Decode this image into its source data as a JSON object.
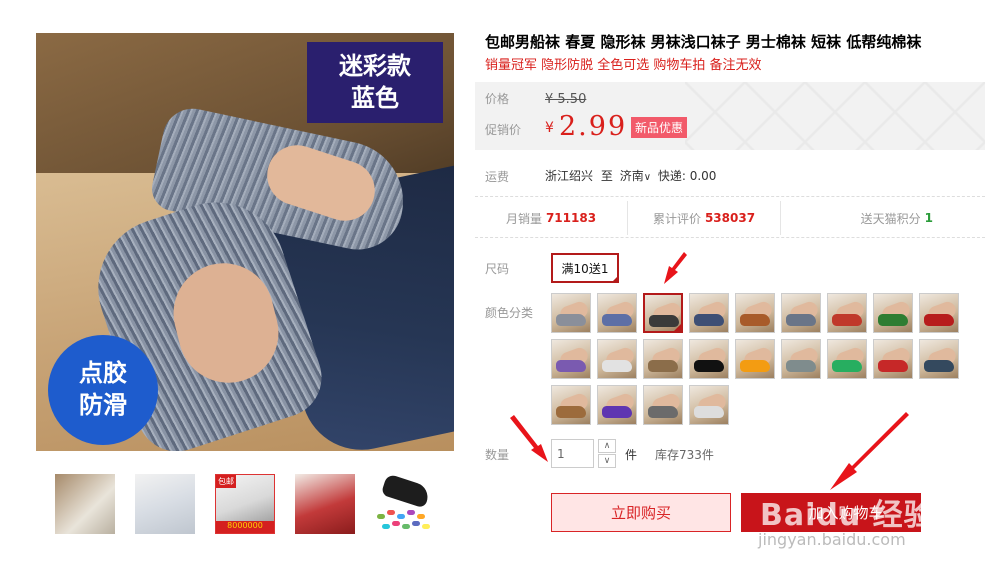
{
  "gallery": {
    "tag_line1": "迷彩款",
    "tag_line2": "蓝色",
    "badge_line1": "点胶",
    "badge_line2": "防滑",
    "thumb3_tag": "包邮",
    "thumb3_band": "8000000"
  },
  "product": {
    "title": "包邮男船袜 春夏 隐形袜 男袜浅口袜子 男士棉袜 短袜 低帮纯棉袜",
    "subtitle": "销量冠军 隐形防脱 全色可选 购物车拍 备注无效"
  },
  "price": {
    "price_label": "价格",
    "original": "¥ 5.50",
    "promo_label": "促销价",
    "currency": "¥",
    "promo_value": "2.99",
    "badge": "新品优惠"
  },
  "shipping": {
    "label": "运费",
    "from": "浙江绍兴",
    "to_word": "至",
    "to": "济南",
    "express": "快递: 0.00"
  },
  "stats": {
    "monthly_label": "月销量",
    "monthly_value": "711183",
    "reviews_label": "累计评价",
    "reviews_value": "538037",
    "points_label": "送天猫积分",
    "points_value": "1"
  },
  "options": {
    "size_label": "尺码",
    "size_value": "满10送1",
    "color_label": "颜色分类",
    "quantity_label": "数量",
    "quantity_value": "1",
    "unit": "件",
    "stock": "库存733件"
  },
  "actions": {
    "buy_now": "立即购买",
    "add_to_cart": "加入购物车"
  },
  "watermark": {
    "brand": "Baidu 经验",
    "site": "jingyan.baidu.com"
  },
  "colors": {
    "accent_red": "#d9201c",
    "dark_red": "#c8141a",
    "green": "#2b9c3a",
    "navy": "#2a1f6e",
    "blue": "#1e5ccd"
  },
  "swatch_colors": [
    "#8a8f9a",
    "#5d6fa6",
    "#3a3a3a",
    "#3e4f75",
    "#a85b2a",
    "#6a7588",
    "#c0392b",
    "#2e7d32",
    "#b71c1c",
    "#7a5ab0",
    "#e2e2e2",
    "#8b6d4a",
    "#111111",
    "#f39c12",
    "#7f8c8d",
    "#27ae60",
    "#c62828",
    "#34495e",
    "#9c6b3c",
    "#5e35b1",
    "#6b6b6b",
    "#dddddd"
  ]
}
